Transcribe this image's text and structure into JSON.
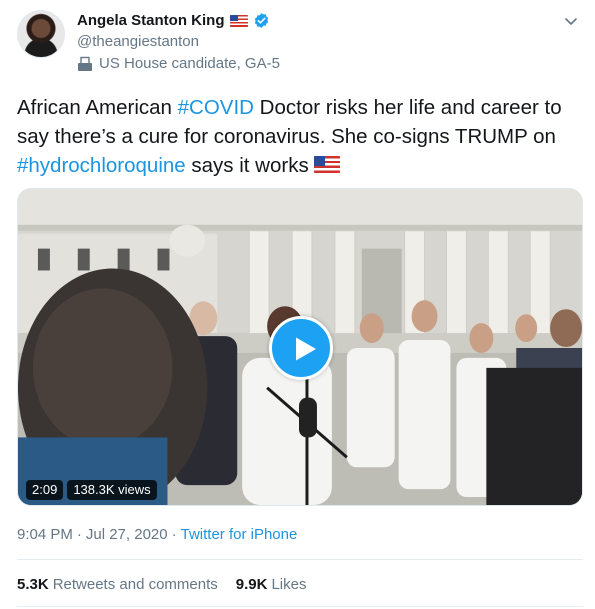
{
  "author": {
    "display_name": "Angela Stanton King",
    "flag_icon": "us-flag-icon",
    "verified_icon": "verified-badge-icon",
    "verified_color": "#1da1f2",
    "handle": "@theangiestanton",
    "bio_icon": "ballot-box-icon",
    "bio_label": "US House candidate, GA-5"
  },
  "menu": {
    "icon": "chevron-down-icon"
  },
  "tweet": {
    "segments": {
      "s1": "African American ",
      "h1": "#COVID",
      "s2": " Doctor risks her life and career to say there’s a cure for coronavirus. She co-signs TRUMP on ",
      "h2": "#hydrochloroquine",
      "s3": " says it works "
    },
    "end_icon": "us-flag-icon",
    "hashtag_color": "#1b95e0"
  },
  "media": {
    "play_icon": "play-icon",
    "play_color": "#1da1f2",
    "duration": "2:09",
    "views": "138.3K views"
  },
  "meta": {
    "time": "9:04 PM",
    "sep1": "·",
    "date": "Jul 27, 2020",
    "sep2": "·",
    "source": "Twitter for iPhone"
  },
  "stats": {
    "retweets_count": "5.3K",
    "retweets_label": "Retweets and comments",
    "likes_count": "9.9K",
    "likes_label": "Likes"
  }
}
